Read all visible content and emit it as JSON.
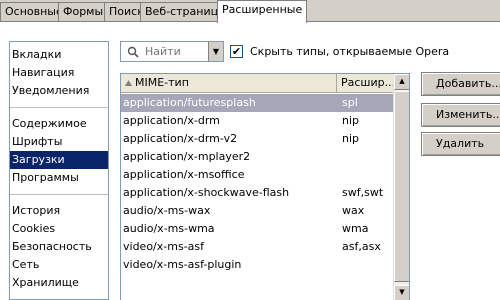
{
  "tabs": [
    "Основные",
    "Формы",
    "Поиск",
    "Веб-страницы",
    "Расширенные"
  ],
  "sidebar": {
    "group1": [
      "Вкладки",
      "Навигация",
      "Уведомления"
    ],
    "group2": [
      "Содержимое",
      "Шрифты",
      "Загрузки",
      "Программы"
    ],
    "group3": [
      "История",
      "Cookies",
      "Безопасность",
      "Сеть",
      "Хранилище"
    ],
    "selected": "Загрузки"
  },
  "search": {
    "placeholder": "Найти"
  },
  "hide_opera_types": {
    "label": "Скрыть типы, открываемые Opera",
    "checked": true
  },
  "table": {
    "col_mime": "MIME-тип",
    "col_ext": "Расшир...",
    "rows": [
      {
        "mime": "application/futuresplash",
        "ext": "spl"
      },
      {
        "mime": "application/x-drm",
        "ext": "nip"
      },
      {
        "mime": "application/x-drm-v2",
        "ext": "nip"
      },
      {
        "mime": "application/x-mplayer2",
        "ext": ""
      },
      {
        "mime": "application/x-msoffice",
        "ext": ""
      },
      {
        "mime": "application/x-shockwave-flash",
        "ext": "swf,swt"
      },
      {
        "mime": "audio/x-ms-wax",
        "ext": "wax"
      },
      {
        "mime": "audio/x-ms-wma",
        "ext": "wma"
      },
      {
        "mime": "video/x-ms-asf",
        "ext": "asf,asx"
      },
      {
        "mime": "video/x-ms-asf-plugin",
        "ext": ""
      }
    ]
  },
  "buttons": {
    "add": "Добавить...",
    "edit": "Изменить...",
    "delete": "Удалить"
  }
}
